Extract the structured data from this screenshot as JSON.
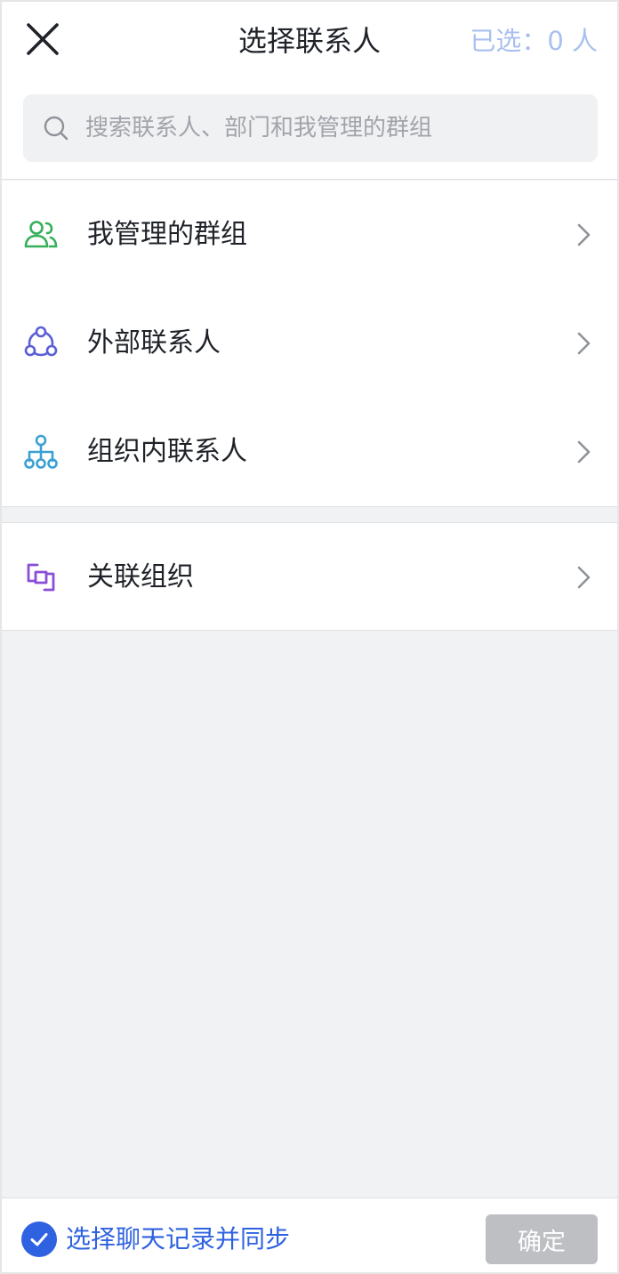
{
  "header": {
    "title": "选择联系人",
    "selected_count": "已选：0 人",
    "close_icon": "close-icon"
  },
  "search": {
    "placeholder": "搜索联系人、部门和我管理的群组",
    "icon": "search-icon"
  },
  "sections": [
    {
      "items": [
        {
          "label": "我管理的群组",
          "icon": "group-users-icon",
          "color": "#34b05a"
        },
        {
          "label": "外部联系人",
          "icon": "external-network-icon",
          "color": "#5b5fd6"
        },
        {
          "label": "组织内联系人",
          "icon": "org-tree-icon",
          "color": "#3aa1d2"
        }
      ]
    },
    {
      "items": [
        {
          "label": "关联组织",
          "icon": "linked-org-icon",
          "color": "#8a4fd6"
        }
      ]
    }
  ],
  "footer": {
    "sync_label": "选择聊天记录并同步",
    "sync_checked": true,
    "confirm_label": "确定"
  },
  "colors": {
    "accent": "#2f62e0",
    "selected_count": "#a9c0ef",
    "disabled_button": "#bdbfc3"
  }
}
